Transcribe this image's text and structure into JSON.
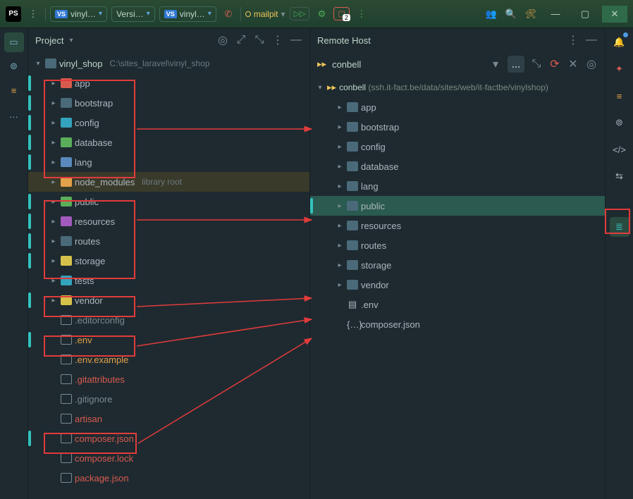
{
  "topbar": {
    "logo": "PS",
    "tabs": [
      {
        "prefix": "VS",
        "label": "vinyl…"
      },
      {
        "prefix": "",
        "label": "Versi…"
      },
      {
        "prefix": "VS",
        "label": "vinyl…"
      }
    ],
    "mailpit": "mailpit",
    "run": "▷▷",
    "cbox_badge": "2"
  },
  "project": {
    "title": "Project",
    "root": {
      "label": "vinyl_shop",
      "path": "C:\\sites_laravel\\vinyl_shop"
    },
    "items": [
      {
        "label": "app",
        "color": "fc-red",
        "marked": true
      },
      {
        "label": "bootstrap",
        "color": "fc-folder",
        "marked": true
      },
      {
        "label": "config",
        "color": "fc-teal",
        "marked": true
      },
      {
        "label": "database",
        "color": "fc-green",
        "marked": true
      },
      {
        "label": "lang",
        "color": "fc-blue",
        "marked": true
      },
      {
        "label": "node_modules",
        "color": "fc-orange",
        "hint": "library root",
        "nodemod": true
      },
      {
        "label": "public",
        "color": "fc-green",
        "marked": true
      },
      {
        "label": "resources",
        "color": "fc-purple",
        "marked": true
      },
      {
        "label": "routes",
        "color": "fc-folder",
        "marked": true
      },
      {
        "label": "storage",
        "color": "fc-yellow",
        "marked": true
      },
      {
        "label": "tests",
        "color": "fc-teal"
      },
      {
        "label": "vendor",
        "color": "fc-yellow",
        "marked": true
      },
      {
        "label": ".editorconfig",
        "color": "fc-file",
        "file": true,
        "grey": true
      },
      {
        "label": ".env",
        "color": "fc-file",
        "file": true,
        "marked": true,
        "orange": true
      },
      {
        "label": ".env.example",
        "color": "fc-file",
        "file": true,
        "orange": true
      },
      {
        "label": ".gitattributes",
        "color": "fc-file",
        "file": true,
        "red": true
      },
      {
        "label": ".gitignore",
        "color": "fc-file",
        "file": true,
        "grey": true
      },
      {
        "label": "artisan",
        "color": "fc-file",
        "file": true,
        "red": true
      },
      {
        "label": "composer.json",
        "color": "fc-file",
        "file": true,
        "marked": true,
        "red": true
      },
      {
        "label": "composer.lock",
        "color": "fc-file",
        "file": true,
        "red": true
      },
      {
        "label": "package.json",
        "color": "fc-file",
        "file": true,
        "red": true
      }
    ]
  },
  "remote": {
    "title": "Remote Host",
    "host": "conbell",
    "root_name": "conbell",
    "root_path": "(ssh.it-fact.be/data/sites/web/it-factbe/vinylshop)",
    "items": [
      {
        "label": "app"
      },
      {
        "label": "bootstrap"
      },
      {
        "label": "config"
      },
      {
        "label": "database"
      },
      {
        "label": "lang"
      },
      {
        "label": "public",
        "selected": true
      },
      {
        "label": "resources"
      },
      {
        "label": "routes"
      },
      {
        "label": "storage"
      },
      {
        "label": "vendor"
      },
      {
        "label": ".env",
        "file": true,
        "fileicon": "▤"
      },
      {
        "label": "composer.json",
        "file": true,
        "fileicon": "{…}"
      }
    ],
    "ellipsis": "…"
  },
  "colors": {
    "red": "#e23b3b",
    "teal": "#34c3bd"
  }
}
